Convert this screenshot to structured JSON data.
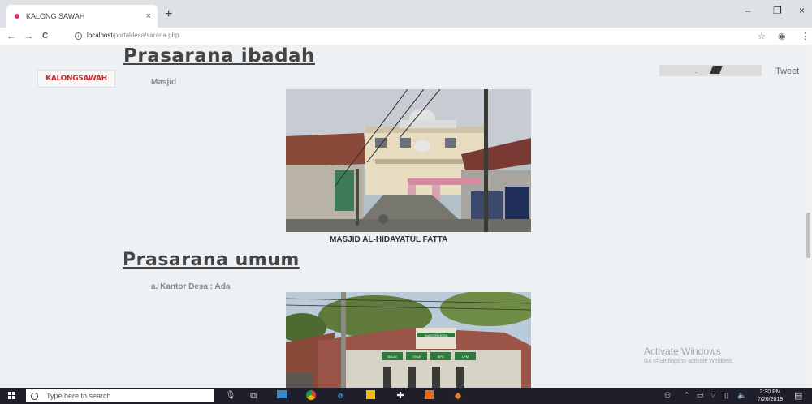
{
  "browser": {
    "tab_title": "KALONG SAWAH",
    "tab_close": "×",
    "new_tab": "+",
    "url_host": "localhost",
    "url_path": "/portaldesa/sarana.php",
    "win_minimize": "–",
    "win_restore": "❐",
    "win_close": "×",
    "nav_back": "←",
    "nav_forward": "→",
    "nav_reload": "C",
    "star": "☆",
    "menu": "⋮"
  },
  "page": {
    "heading_ibadah": "Prasarana ibadah",
    "logo_text": "KALONGSAWAH",
    "masjid_label": "Masjid",
    "photo1_caption": "MASJID AL-HIDAYATUL FATTA",
    "heading_umum": "Prasarana umum",
    "kantor_label": "a.   Kantor Desa : Ada",
    "tweet_label": "Tweet",
    "tweet_dot": ".",
    "office_sign": "KANTOR DESA",
    "office_boards": [
      "BALAI",
      "ITINA",
      "BPD",
      "LPM"
    ]
  },
  "watermark": {
    "line1": "Activate Windows",
    "line2": "Go to Settings to activate Windows."
  },
  "taskbar": {
    "search_placeholder": "Type here to search",
    "time": "2:30 PM",
    "date": "7/26/2019"
  }
}
